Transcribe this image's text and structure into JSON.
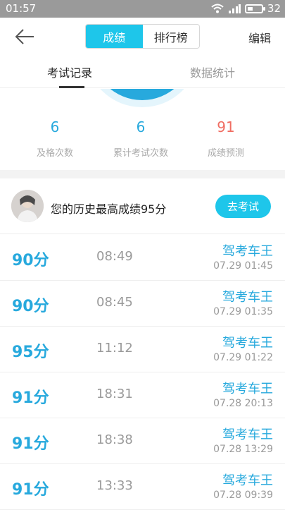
{
  "status_bar": {
    "time": "01:57",
    "battery_text": "32"
  },
  "nav": {
    "segments": [
      "成绩",
      "排行榜"
    ],
    "active_segment": "成绩",
    "edit_label": "编辑"
  },
  "tabs": {
    "items": [
      "考试记录",
      "数据统计"
    ],
    "active": "考试记录"
  },
  "stats": [
    {
      "value": "6",
      "label": "及格次数"
    },
    {
      "value": "6",
      "label": "累计考试次数"
    },
    {
      "value": "91",
      "label": "成绩预测"
    }
  ],
  "best": {
    "text": "您的历史最高成绩95分",
    "button_label": "去考试"
  },
  "records": [
    {
      "score": "90分",
      "duration": "08:49",
      "brand": "驾考车王",
      "datetime": "07.29  01:45"
    },
    {
      "score": "90分",
      "duration": "08:45",
      "brand": "驾考车王",
      "datetime": "07.29  01:35"
    },
    {
      "score": "95分",
      "duration": "11:12",
      "brand": "驾考车王",
      "datetime": "07.29  01:22"
    },
    {
      "score": "91分",
      "duration": "18:31",
      "brand": "驾考车王",
      "datetime": "07.28  20:13"
    },
    {
      "score": "91分",
      "duration": "18:38",
      "brand": "驾考车王",
      "datetime": "07.28  13:29"
    },
    {
      "score": "91分",
      "duration": "13:33",
      "brand": "驾考车王",
      "datetime": "07.28  09:39"
    }
  ],
  "colors": {
    "accent": "#1ec6ea",
    "score_blue": "#27a9dd",
    "prediction_red": "#f06d62",
    "status_bar": "#9a9a9a"
  }
}
